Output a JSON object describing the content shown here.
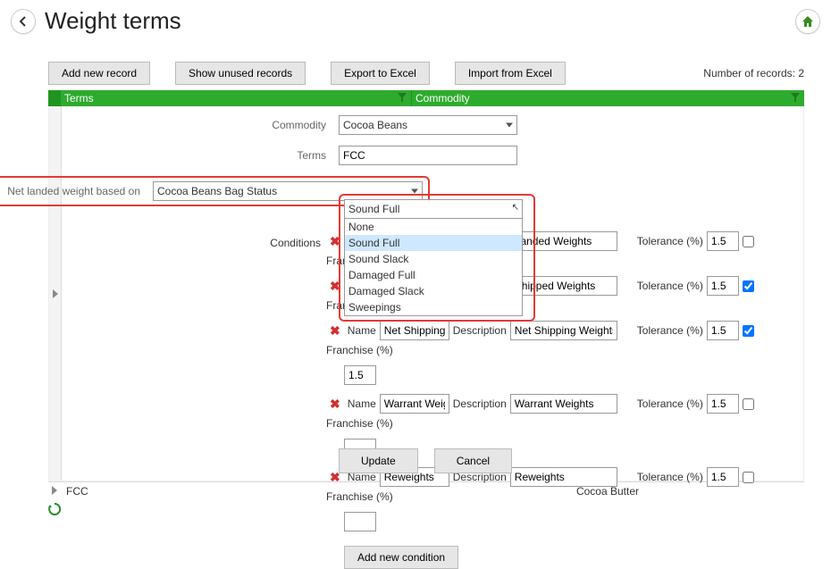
{
  "page_title": "Weight terms",
  "toolbar": {
    "add_new_record": "Add new record",
    "show_unused": "Show unused records",
    "export_excel": "Export to Excel",
    "import_excel": "Import from Excel"
  },
  "record_count": "Number of records: 2",
  "grid_header": {
    "terms": "Terms",
    "commodity": "Commodity"
  },
  "form": {
    "commodity_label": "Commodity",
    "commodity_value": "Cocoa Beans",
    "terms_label": "Terms",
    "terms_value": "FCC",
    "nlw_label": "Net landed weight based on",
    "nlw_value": "Cocoa Beans Bag Status",
    "conditions_label": "Conditions"
  },
  "status_dropdown": {
    "selected_display": "Sound Full",
    "options": [
      "None",
      "Sound Full",
      "Sound Slack",
      "Damaged Full",
      "Damaged Slack",
      "Sweepings"
    ]
  },
  "condition_labels": {
    "name": "Name",
    "description": "Description",
    "tolerance": "Tolerance (%)",
    "franchise": "Franchise (%)"
  },
  "conditions": [
    {
      "name": "",
      "description": "Landed Weights",
      "tolerance": "1.5",
      "franchise": false,
      "extra_value": "",
      "show_extra_line": false
    },
    {
      "name": "",
      "description": "Shipped Weights",
      "tolerance": "1.5",
      "franchise": true,
      "extra_value": "",
      "show_extra_line": false
    },
    {
      "name": "Net Shipping We",
      "description": "Net Shipping Weights",
      "tolerance": "1.5",
      "franchise": true,
      "extra_value": "1.5",
      "show_extra_line": true
    },
    {
      "name": "Warrant Weigths",
      "description": "Warrant Weights",
      "tolerance": "1.5",
      "franchise": false,
      "extra_value": "",
      "show_extra_line": true
    },
    {
      "name": "Reweights",
      "description": "Reweights",
      "tolerance": "1.5",
      "franchise": false,
      "extra_value": "",
      "show_extra_line": true
    }
  ],
  "buttons": {
    "add_condition": "Add new condition",
    "update": "Update",
    "cancel": "Cancel"
  },
  "footer_row": {
    "terms": "FCC",
    "commodity": "Cocoa Butter"
  }
}
